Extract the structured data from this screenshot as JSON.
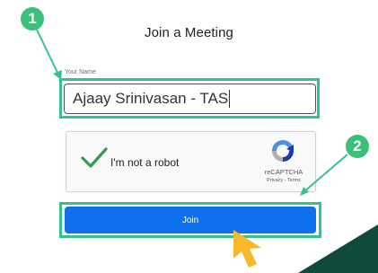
{
  "dialog": {
    "title": "Join a Meeting"
  },
  "name_field": {
    "label": "Your Name",
    "value": "Ajaay Srinivasan - TAS"
  },
  "captcha": {
    "checked": true,
    "label": "I'm not a robot",
    "brand": "reCAPTCHA",
    "links": "Privacy - Terms"
  },
  "join_button": {
    "label": "Join"
  },
  "annotations": {
    "step1": "1",
    "step2": "2"
  },
  "colors": {
    "highlight": "#33c48e",
    "badge": "#3bbf7a",
    "join_button": "#0e71eb",
    "checkmark": "#2e9e4e",
    "cursor": "#f7b82b",
    "corner_shape": "#0f4a3d"
  }
}
